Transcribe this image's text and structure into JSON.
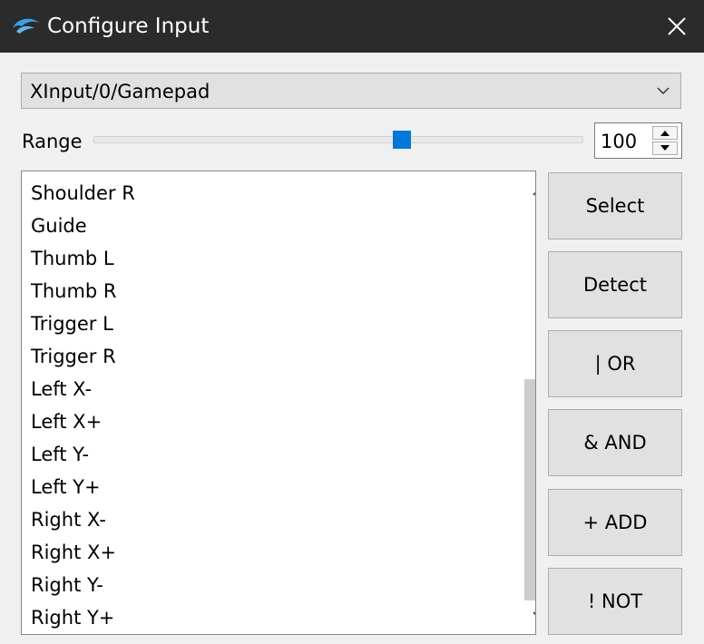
{
  "window": {
    "title": "Configure Input",
    "icon": "dolphin-icon",
    "close_icon": "close-icon",
    "colors": {
      "titlebar": "#2b2b2b",
      "accent": "#0078d7"
    }
  },
  "device": {
    "selected": "XInput/0/Gamepad"
  },
  "range": {
    "label": "Range",
    "value": "100",
    "slider_percent": 63
  },
  "inputs": [
    "Shoulder R",
    "Guide",
    "Thumb L",
    "Thumb R",
    "Trigger L",
    "Trigger R",
    "Left X-",
    "Left X+",
    "Left Y-",
    "Left Y+",
    "Right X-",
    "Right X+",
    "Right Y-",
    "Right Y+"
  ],
  "actions": {
    "select": "Select",
    "detect": "Detect",
    "or": "| OR",
    "and": "& AND",
    "add": "+ ADD",
    "not": "! NOT"
  }
}
